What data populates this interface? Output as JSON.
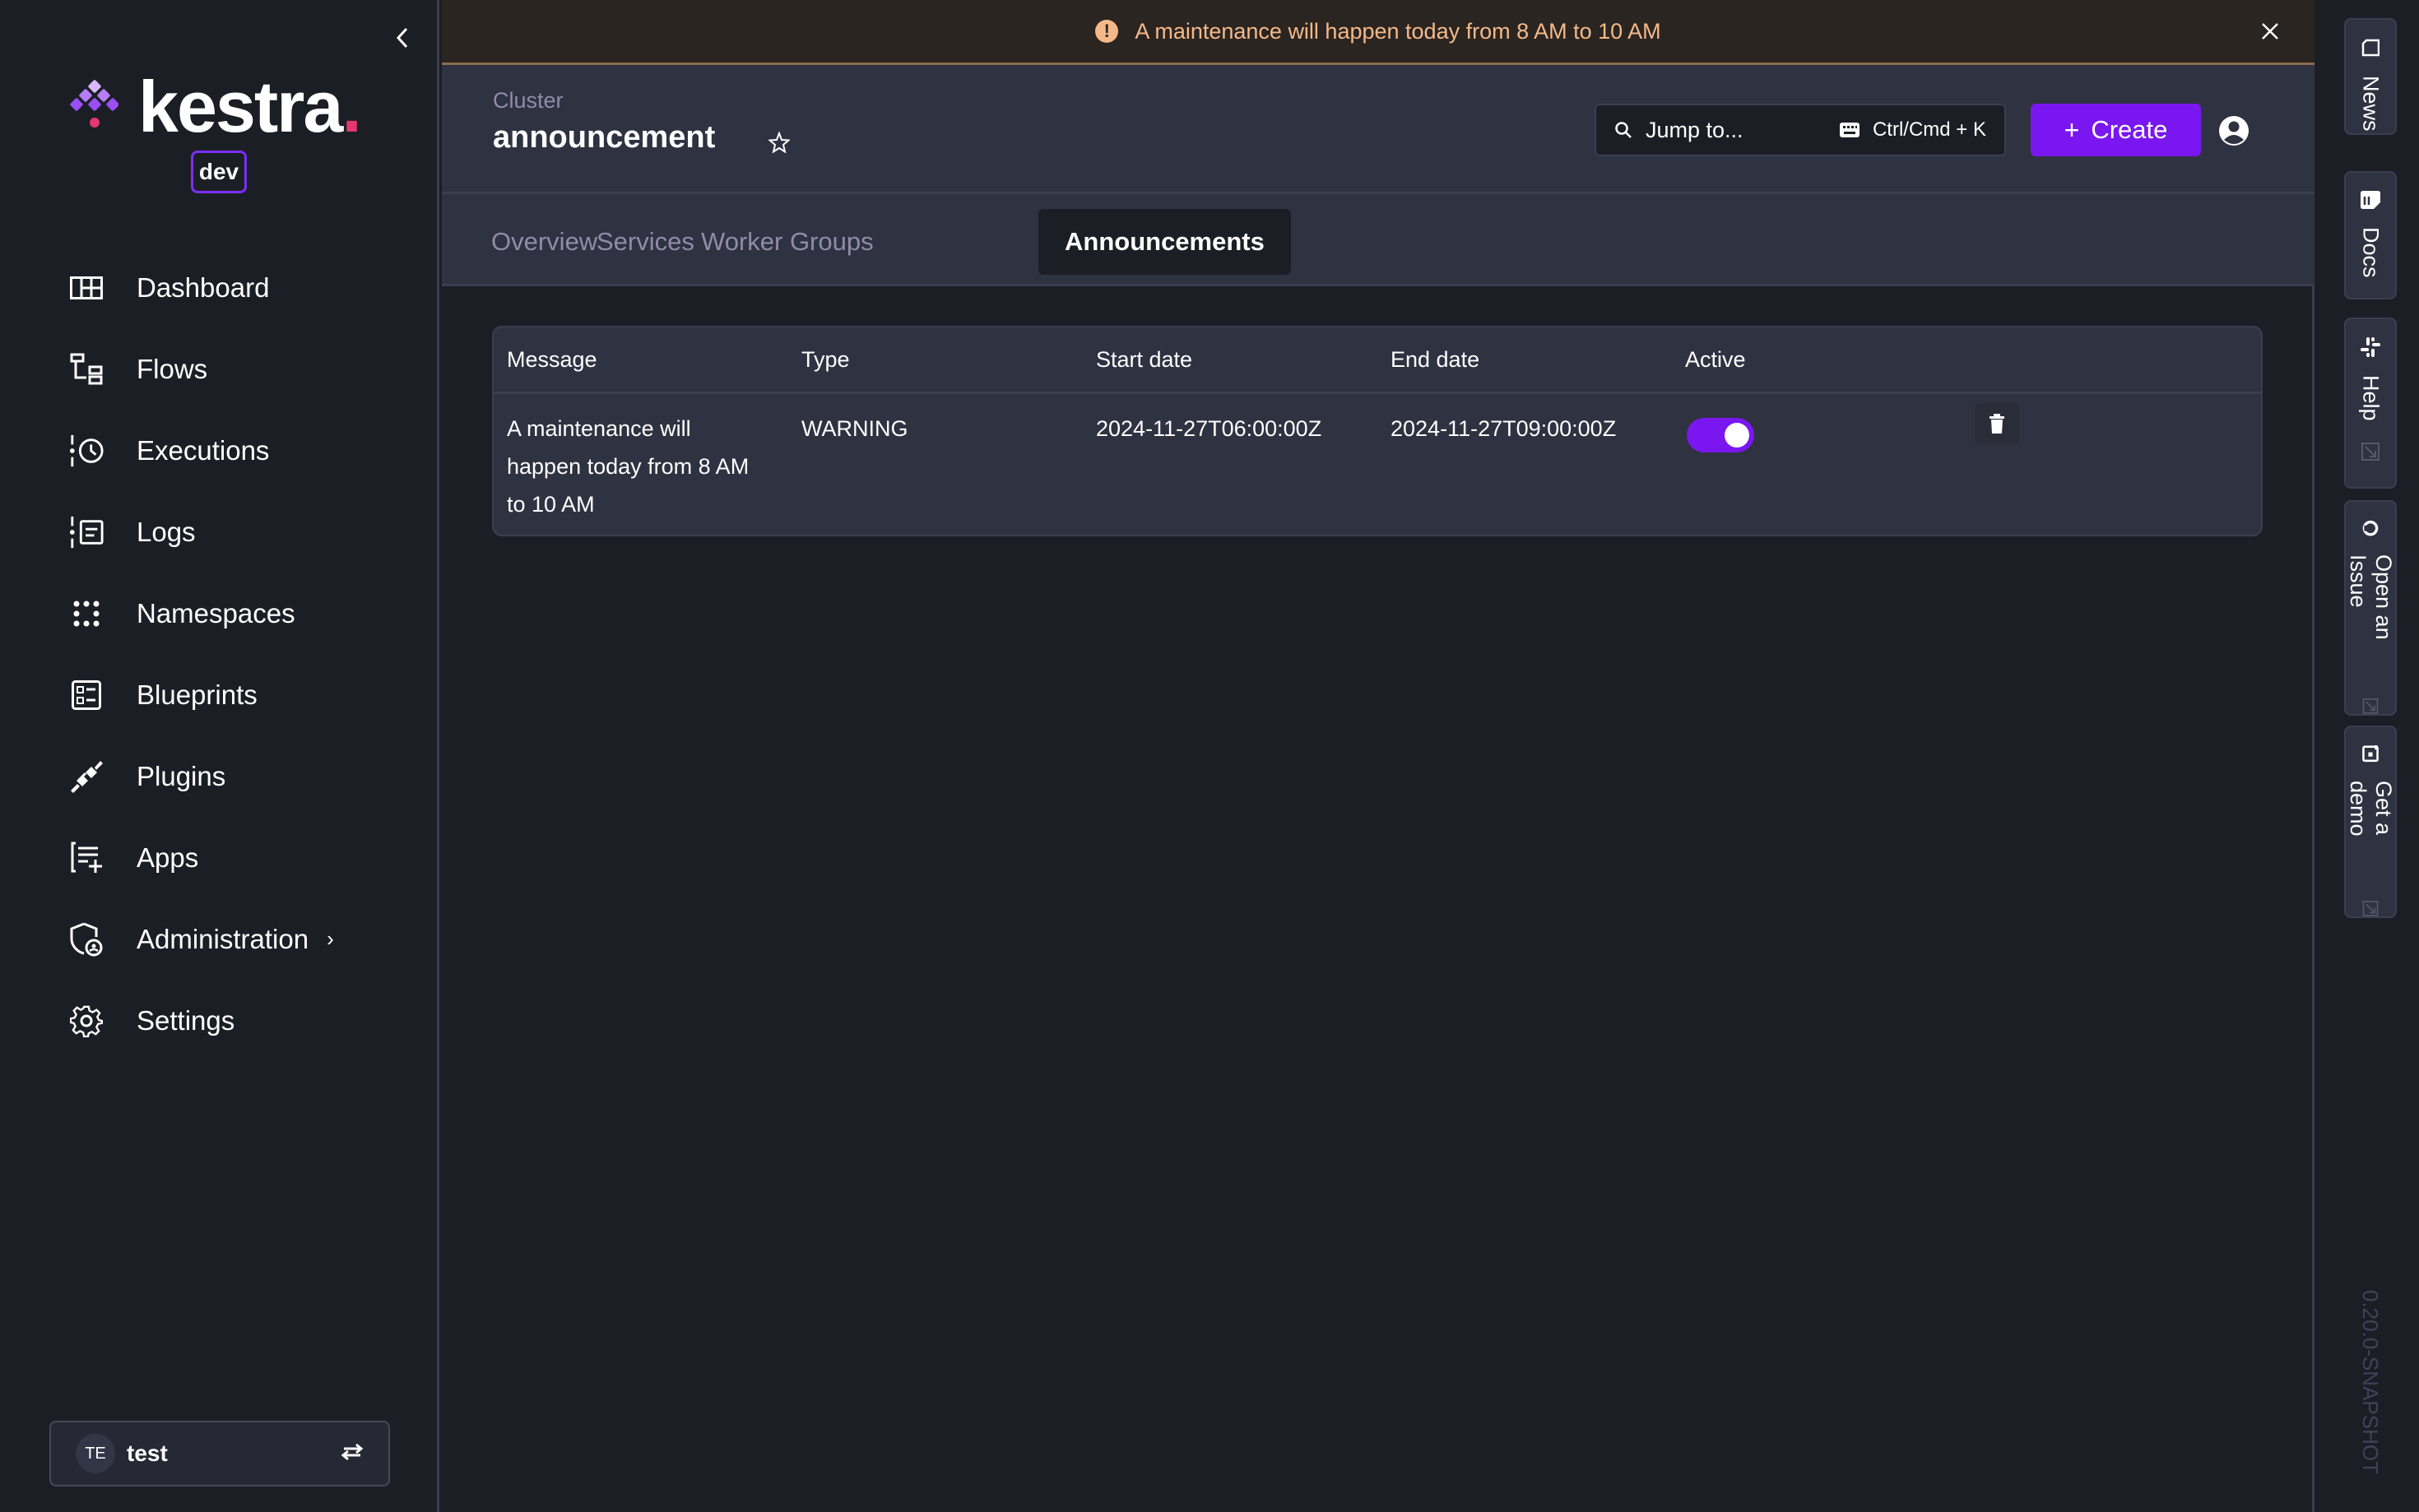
{
  "sidebar": {
    "logo_text": "kestra",
    "logo_dot": ".",
    "env_badge": "dev",
    "items": [
      {
        "label": "Dashboard",
        "icon": "dashboard-icon"
      },
      {
        "label": "Flows",
        "icon": "flows-icon"
      },
      {
        "label": "Executions",
        "icon": "executions-icon"
      },
      {
        "label": "Logs",
        "icon": "logs-icon"
      },
      {
        "label": "Namespaces",
        "icon": "namespaces-icon"
      },
      {
        "label": "Blueprints",
        "icon": "blueprints-icon"
      },
      {
        "label": "Plugins",
        "icon": "plugins-icon"
      },
      {
        "label": "Apps",
        "icon": "apps-icon"
      },
      {
        "label": "Administration",
        "icon": "administration-icon",
        "has_submenu": true
      },
      {
        "label": "Settings",
        "icon": "settings-icon"
      }
    ],
    "tenant": {
      "initials": "TE",
      "name": "test"
    }
  },
  "banner": {
    "type": "warning",
    "message": "A maintenance will happen today from 8 AM to 10 AM",
    "icon_glyph": "!"
  },
  "header": {
    "breadcrumb": "Cluster",
    "title": "announcement",
    "jump_label": "Jump to...",
    "jump_shortcut": "Ctrl/Cmd + K",
    "create_label": "Create",
    "create_plus": "+"
  },
  "tabs": [
    {
      "label": "Overview",
      "active": false
    },
    {
      "label": "Services",
      "active": false
    },
    {
      "label": "Worker Groups",
      "active": false
    },
    {
      "label": "Announcements",
      "active": true
    }
  ],
  "table": {
    "columns": [
      "Message",
      "Type",
      "Start date",
      "End date",
      "Active"
    ],
    "rows": [
      {
        "message": "A maintenance will happen today from 8 AM to 10 AM",
        "message_lines": [
          "A maintenance will",
          "happen today from 8 AM",
          "to 10 AM"
        ],
        "type": "WARNING",
        "start_date": "2024-11-27T06:00:00Z",
        "end_date": "2024-11-27T09:00:00Z",
        "active": true
      }
    ]
  },
  "rail": {
    "items": [
      {
        "label": "News",
        "icon": "news-icon",
        "external": false
      },
      {
        "label": "Docs",
        "icon": "docs-icon",
        "external": false
      },
      {
        "label": "Help",
        "icon": "slack-icon",
        "external": true
      },
      {
        "label": "Open an Issue",
        "icon": "github-icon",
        "external": true
      },
      {
        "label": "Get a demo",
        "icon": "demo-icon",
        "external": true
      }
    ],
    "version": "0.20.0-SNAPSHOT"
  },
  "colors": {
    "accent": "#7a17f0",
    "warning_text": "#f5b989",
    "warning_bg": "#2a2521",
    "logo_dot": "#e2376f"
  }
}
